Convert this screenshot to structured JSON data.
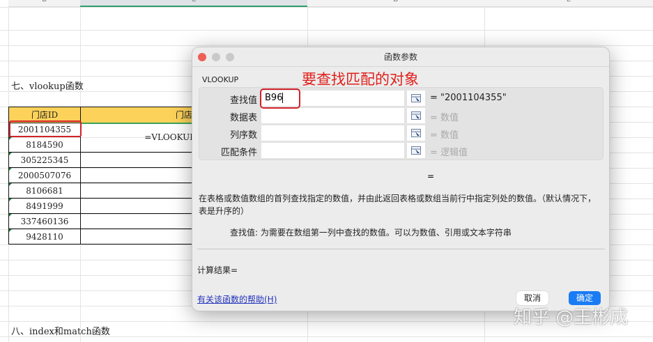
{
  "sheet": {
    "columns": [
      "B",
      "C",
      "D",
      "E"
    ],
    "section7": "七、vlookup函数",
    "section8": "八、index和match函数",
    "table": {
      "header_id": "门店ID",
      "header_name": "门店",
      "formula": "=VLOOKUP(",
      "ids": [
        "2001104355",
        "8184590",
        "305225345",
        "2000507076",
        "8106681",
        "8491999",
        "337460136",
        "9428110"
      ]
    }
  },
  "dialog": {
    "title": "函数参数",
    "function": "VLOOKUP",
    "annotation": "要查找匹配的对象",
    "args": [
      {
        "label": "查找值",
        "value": "B96",
        "result": "= \"2001104355\""
      },
      {
        "label": "数据表",
        "value": "",
        "result": "= 数值"
      },
      {
        "label": "列序数",
        "value": "",
        "result": "= 数值"
      },
      {
        "label": "匹配条件",
        "value": "",
        "result": "= 逻辑值"
      }
    ],
    "result_eq": "=",
    "description": "在表格或数值数组的首列查找指定的数值，并由此返回表格或数组当前行中指定列处的数值。（默认情况下，表是升序的）",
    "arg_help": "查找值: 为需要在数组第一列中查找的数值。可以为数值、引用或文本字符串",
    "calc_result": "计算结果=",
    "help_link": "有关该函数的帮助(H)",
    "cancel": "取消",
    "ok": "确定",
    "colors": {
      "accent": "#1a7cf5",
      "annotation": "#e0201c"
    }
  },
  "watermark": "知乎 @王彬成"
}
